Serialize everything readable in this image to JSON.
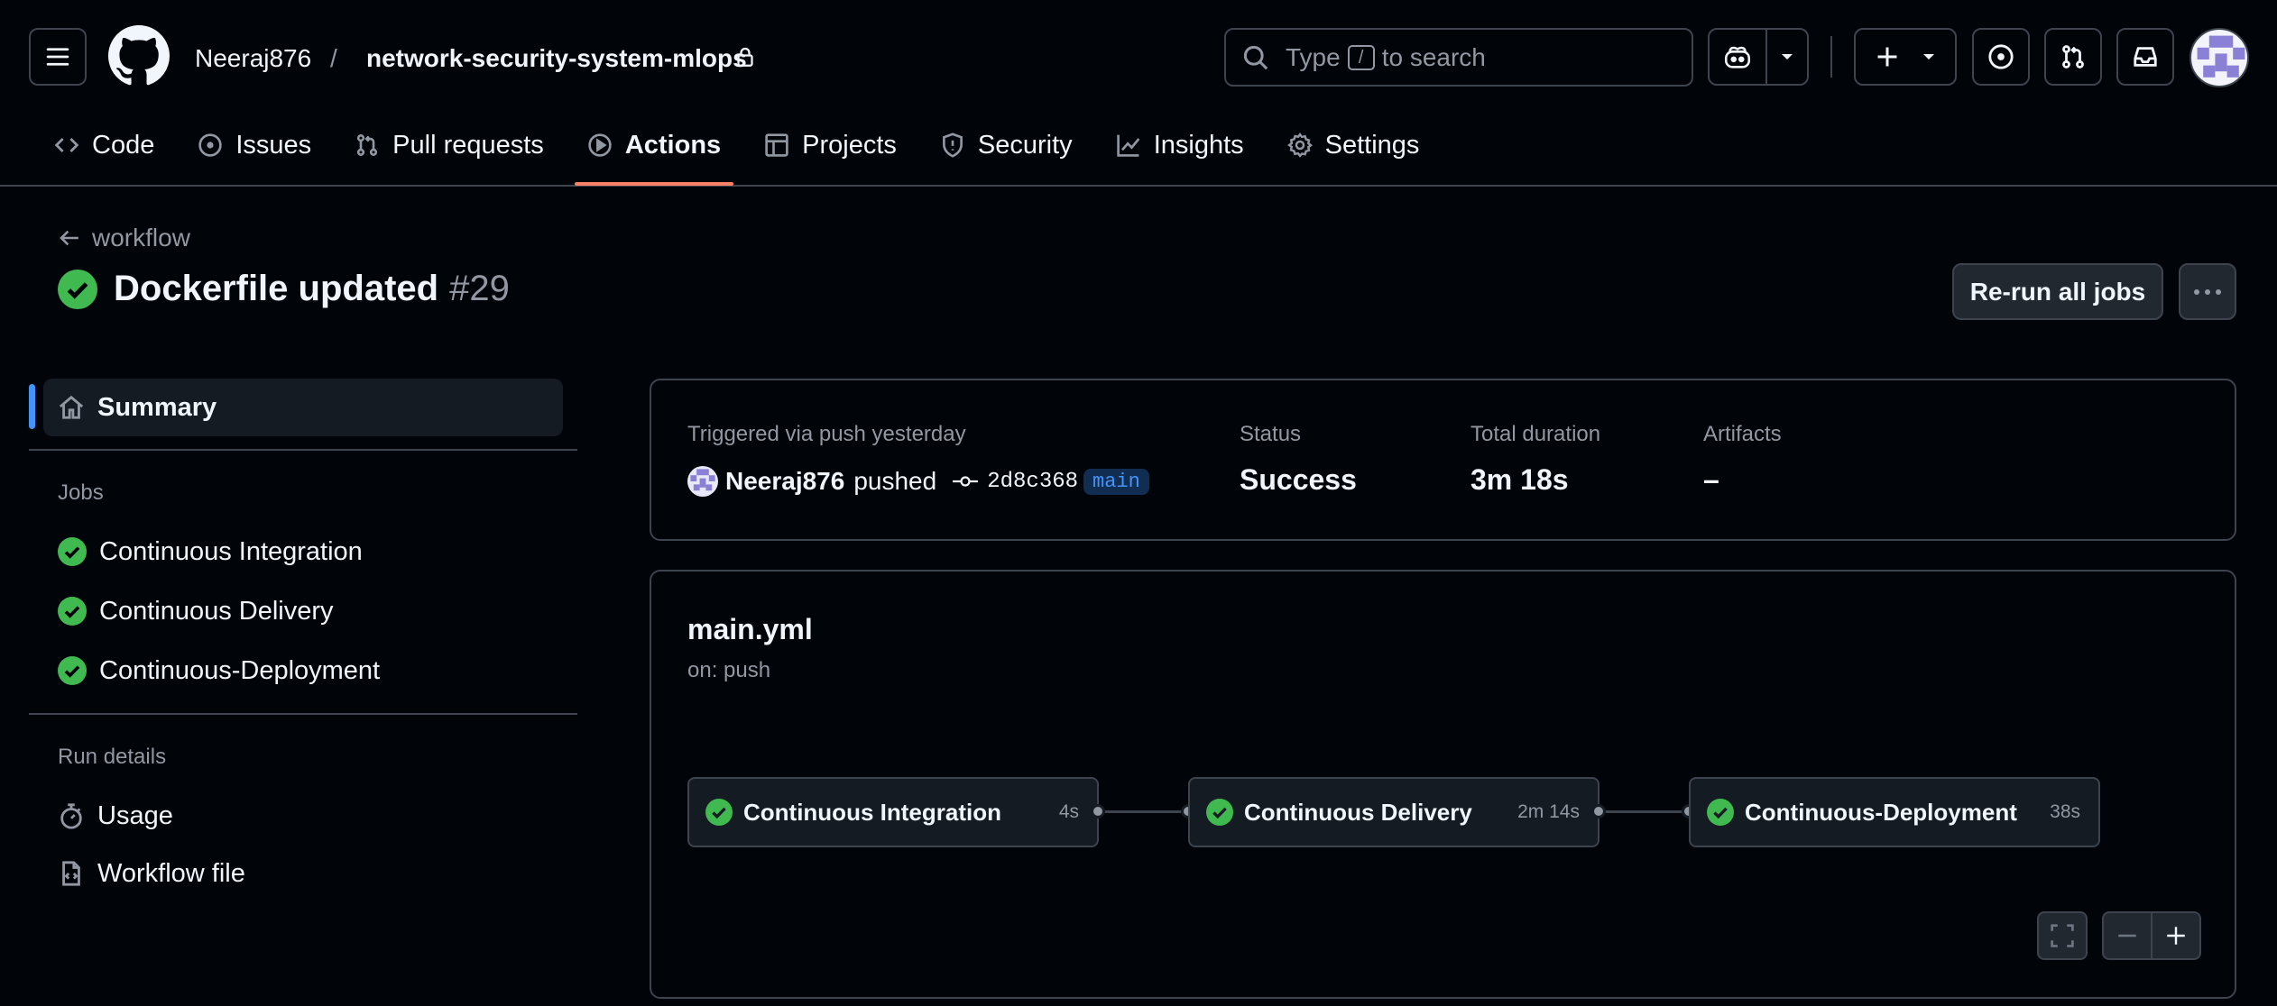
{
  "header": {
    "owner": "Neeraj876",
    "separator": "/",
    "repo": "network-security-system-mlops",
    "search_prefix": "Type",
    "search_key": "/",
    "search_suffix": "to search"
  },
  "tabs": [
    {
      "label": "Code",
      "icon": "code-icon"
    },
    {
      "label": "Issues",
      "icon": "issue-icon"
    },
    {
      "label": "Pull requests",
      "icon": "pull-request-icon"
    },
    {
      "label": "Actions",
      "icon": "play-icon",
      "active": true
    },
    {
      "label": "Projects",
      "icon": "table-icon"
    },
    {
      "label": "Security",
      "icon": "shield-icon"
    },
    {
      "label": "Insights",
      "icon": "graph-icon"
    },
    {
      "label": "Settings",
      "icon": "gear-icon"
    }
  ],
  "run": {
    "back_label": "workflow",
    "title": "Dockerfile updated",
    "number": "#29",
    "rerun_label": "Re-run all jobs"
  },
  "sidebar": {
    "summary_label": "Summary",
    "jobs_title": "Jobs",
    "jobs": [
      "Continuous Integration",
      "Continuous Delivery",
      "Continuous-Deployment"
    ],
    "run_details_title": "Run details",
    "usage_label": "Usage",
    "workflow_file_label": "Workflow file"
  },
  "summary": {
    "trigger_label": "Triggered via push yesterday",
    "actor": "Neeraj876",
    "action": "pushed",
    "commit": "2d8c368",
    "branch": "main",
    "status_label": "Status",
    "status_value": "Success",
    "duration_label": "Total duration",
    "duration_value": "3m 18s",
    "artifacts_label": "Artifacts",
    "artifacts_value": "–"
  },
  "workflow": {
    "file": "main.yml",
    "trigger": "on: push",
    "jobs": [
      {
        "name": "Continuous Integration",
        "duration": "4s"
      },
      {
        "name": "Continuous Delivery",
        "duration": "2m 14s"
      },
      {
        "name": "Continuous-Deployment",
        "duration": "38s"
      }
    ]
  },
  "colors": {
    "accent": "#4493f8",
    "success": "#3fb950",
    "tab_underline": "#f78166",
    "background": "#010409",
    "border": "#3d444d"
  }
}
